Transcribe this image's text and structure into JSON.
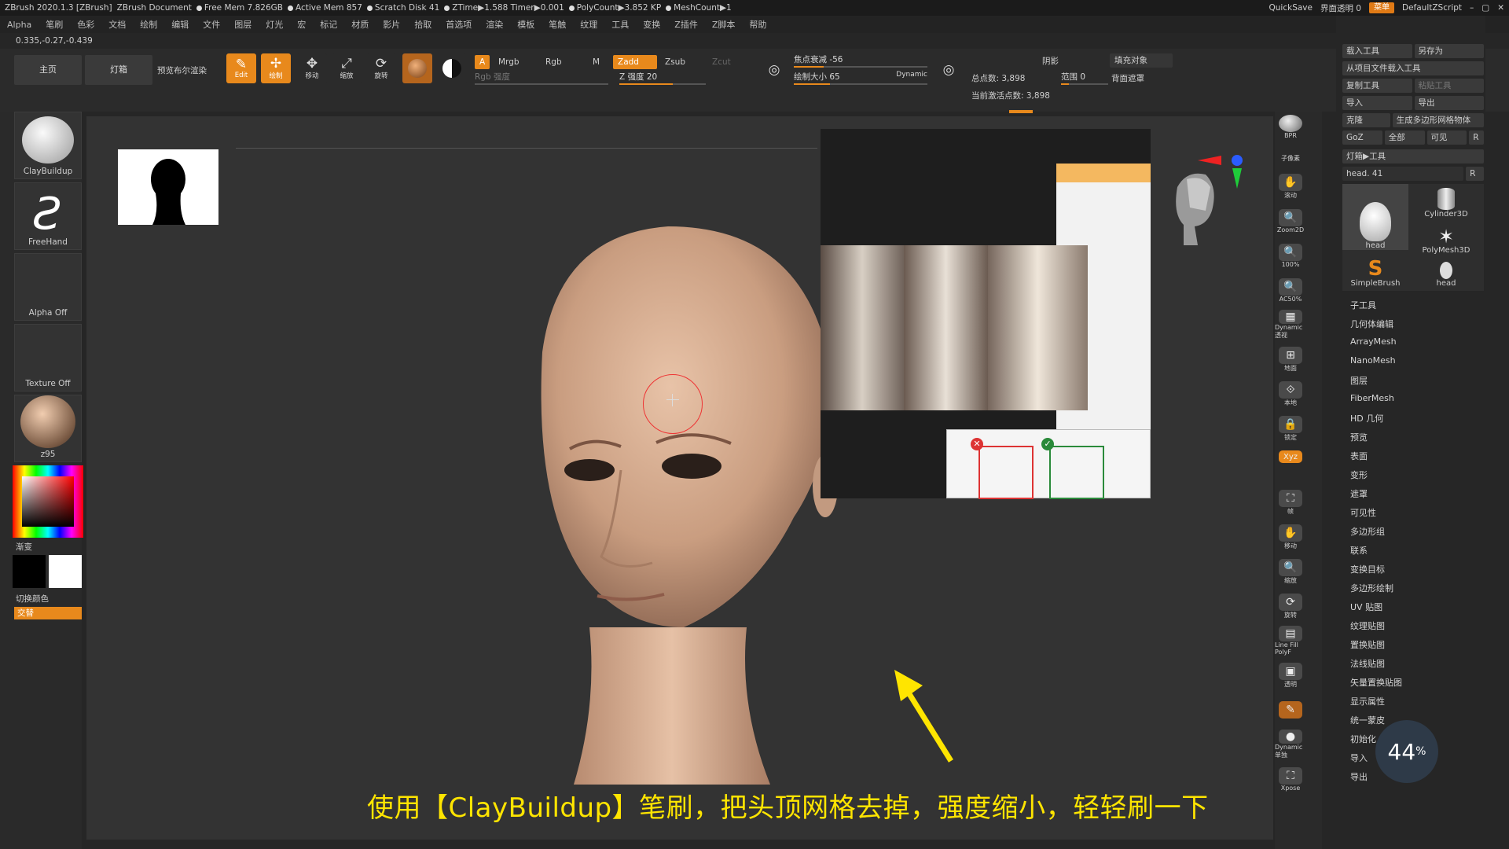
{
  "titlebar": {
    "app": "ZBrush 2020.1.3 [ZBrush]",
    "document": "ZBrush Document",
    "stats": [
      "Free Mem 7.826GB",
      "Active Mem 857",
      "Scratch Disk 41",
      "ZTime▶1.588 Timer▶0.001",
      "PolyCount▶3.852 KP",
      "MeshCount▶1"
    ],
    "quicksave": "QuickSave",
    "transparency": "界面透明 0",
    "menu_btn": "菜单",
    "script": "DefaultZScript"
  },
  "menubar": [
    "Alpha",
    "笔刷",
    "色彩",
    "文档",
    "绘制",
    "编辑",
    "文件",
    "图层",
    "灯光",
    "宏",
    "标记",
    "材质",
    "影片",
    "拾取",
    "首选项",
    "渲染",
    "模板",
    "笔触",
    "纹理",
    "工具",
    "变换",
    "Z插件",
    "Z脚本",
    "帮助"
  ],
  "coords": "0.335,-0.27,-0.439",
  "toolbar": {
    "home": "主页",
    "lightbox": "灯箱",
    "preview_bool": "预览布尔渲染",
    "edit": "Edit",
    "draw": "绘制",
    "move": "移动",
    "scale": "缩放",
    "rotate": "旋转",
    "a_chip": "A",
    "mrgb": "Mrgb",
    "rgb": "Rgb",
    "m": "M",
    "zadd": "Zadd",
    "zsub": "Zsub",
    "zcut": "Zcut",
    "rgb_intensity": "Rgb 强度",
    "z_intensity": "Z 强度 20",
    "focal_shift": "焦点衰减 -56",
    "draw_size": "绘制大小 65",
    "dynamic": "Dynamic",
    "total_points": "总点数: 3,898",
    "active_points": "当前激活点数: 3,898",
    "shadow": "阴影",
    "range": "范围 0",
    "fill_object": "填充对象",
    "back_mask": "背面遮罩"
  },
  "leftshelf": {
    "brush": "ClayBuildup",
    "stroke": "FreeHand",
    "alpha": "Alpha Off",
    "texture": "Texture Off",
    "material": "z95",
    "gradient": "渐变",
    "switch_color": "切换颜色",
    "alternate": "交替"
  },
  "rightshelf": [
    "BPR",
    "子像素",
    "滚动",
    "Zoom2D",
    "100%",
    "AC50%",
    "Dynamic 透视",
    "地面",
    "本地",
    "锁定",
    "Xyz",
    "",
    "",
    "帧",
    "移动",
    "缩放",
    "旋转",
    "Line Fill PolyF",
    "透明",
    "",
    "Dynamic 单独",
    "Xpose"
  ],
  "toolpanel": {
    "row1": [
      "载入工具",
      "另存为"
    ],
    "row2": [
      "从项目文件载入工具"
    ],
    "row3": [
      "复制工具",
      "粘贴工具"
    ],
    "row4": [
      "导入",
      "导出"
    ],
    "row5": [
      "克隆",
      "生成多边形网格物体"
    ],
    "row6": [
      "GoZ",
      "全部",
      "可见",
      "R"
    ],
    "lightbox_tools": "灯箱▶工具",
    "current": "head. 41",
    "r": "R",
    "tiles": [
      "head",
      "Cylinder3D",
      "PolyMesh3D",
      "SimpleBrush",
      "head"
    ],
    "menu": [
      "子工具",
      "几何体编辑",
      "ArrayMesh",
      "NanoMesh",
      "图层",
      "FiberMesh",
      "HD 几何",
      "预览",
      "表面",
      "变形",
      "遮罩",
      "可见性",
      "多边形组",
      "联系",
      "变换目标",
      "多边形绘制",
      "UV 贴图",
      "纹理贴图",
      "置换贴图",
      "法线贴图",
      "矢量置换贴图",
      "显示属性",
      "统一蒙皮",
      "初始化",
      "导入",
      "导出"
    ]
  },
  "progress": {
    "value": "44",
    "unit": "%"
  },
  "subtitle": "使用【ClayBuildup】笔刷，把头顶网格去掉，强度缩小，轻轻刷一下",
  "reference": {
    "icons_note": ""
  }
}
